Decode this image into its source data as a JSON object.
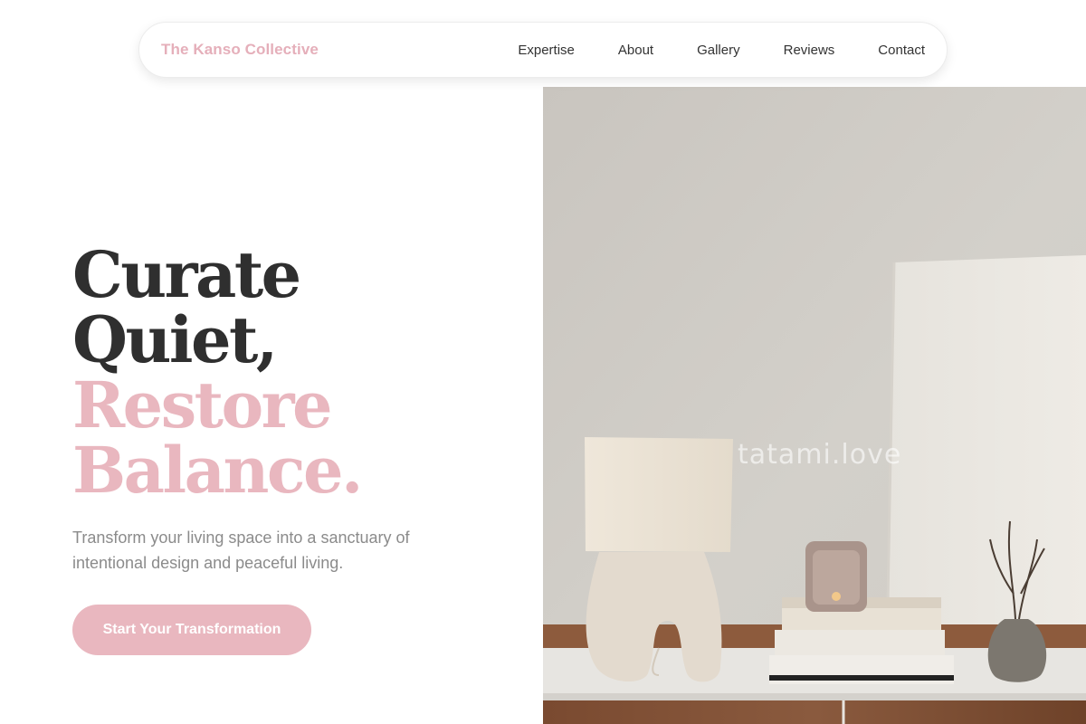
{
  "brand": "The Kanso Collective",
  "nav": {
    "links": [
      "Expertise",
      "About",
      "Gallery",
      "Reviews",
      "Contact"
    ]
  },
  "hero": {
    "headline": [
      "Curate",
      "Quiet,",
      "Restore",
      "Balance."
    ],
    "subtitle": "Transform your living space into a sanctuary of intentional design and peaceful living.",
    "cta_label": "Start Your Transformation",
    "image_watermark": "tatami.love"
  },
  "colors": {
    "accent": "#e9b7bf",
    "text_dark": "#2f2f2f",
    "text_muted": "#8b8b8b"
  }
}
